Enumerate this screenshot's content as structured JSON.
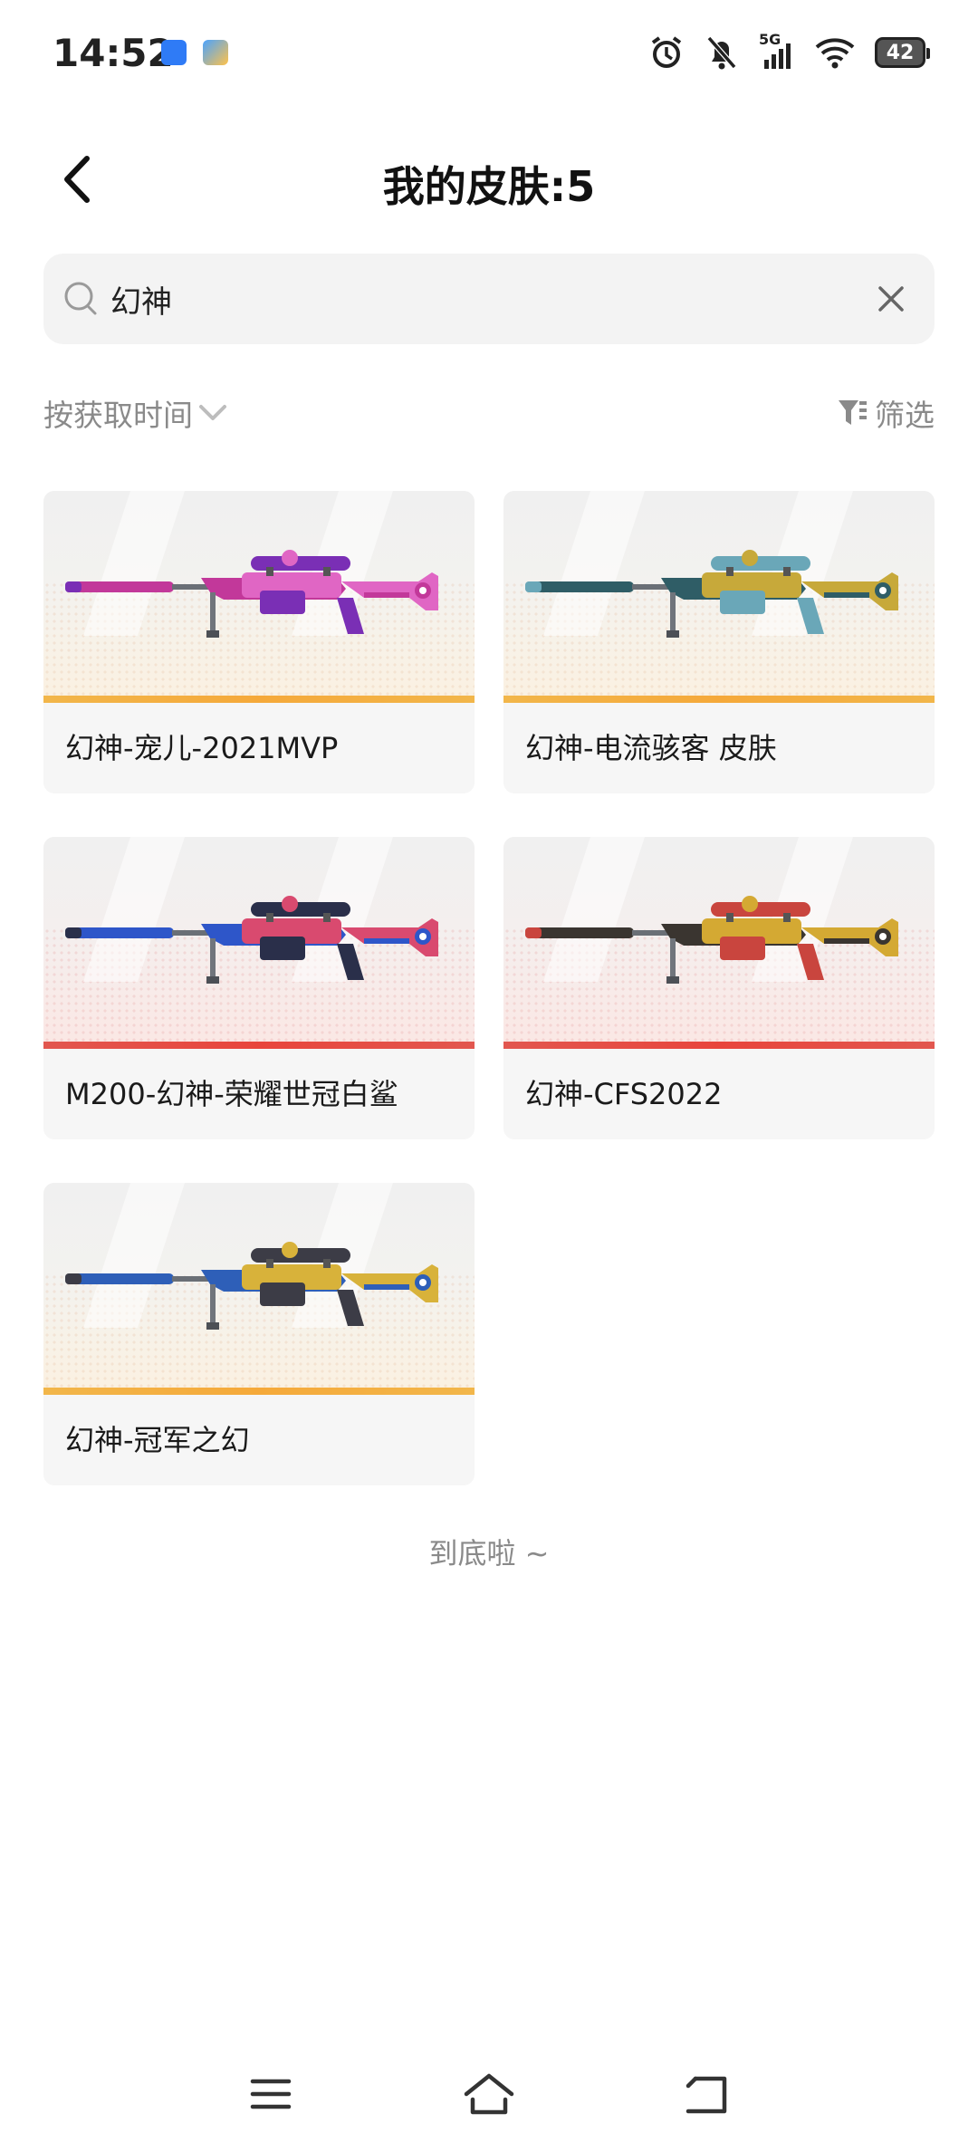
{
  "status_bar": {
    "time": "14:52",
    "network": "5G",
    "battery": "42"
  },
  "header": {
    "title": "我的皮肤:5"
  },
  "search": {
    "value": "幻神",
    "placeholder": ""
  },
  "toolbar": {
    "sort_label": "按获取时间",
    "filter_label": "筛选"
  },
  "skins": [
    {
      "name": "幻神-宠儿-2021MVP",
      "theme": "gold",
      "colors": [
        "#c2389a",
        "#e066c4",
        "#7a2fb5"
      ]
    },
    {
      "name": "幻神-电流骇客 皮肤",
      "theme": "gold",
      "colors": [
        "#2f5d66",
        "#c7a93a",
        "#6aa7b8"
      ]
    },
    {
      "name": "M200-幻神-荣耀世冠白鲨",
      "theme": "red",
      "colors": [
        "#2e56c9",
        "#d94a6f",
        "#2a2f4a"
      ]
    },
    {
      "name": "幻神-CFS2022",
      "theme": "red",
      "colors": [
        "#3a3530",
        "#d4a933",
        "#c9453e"
      ]
    },
    {
      "name": "幻神-冠军之幻",
      "theme": "gold",
      "colors": [
        "#2e5fb8",
        "#d8b23a",
        "#3c3c46"
      ]
    }
  ],
  "footer": {
    "end_text": "到底啦 ~"
  }
}
